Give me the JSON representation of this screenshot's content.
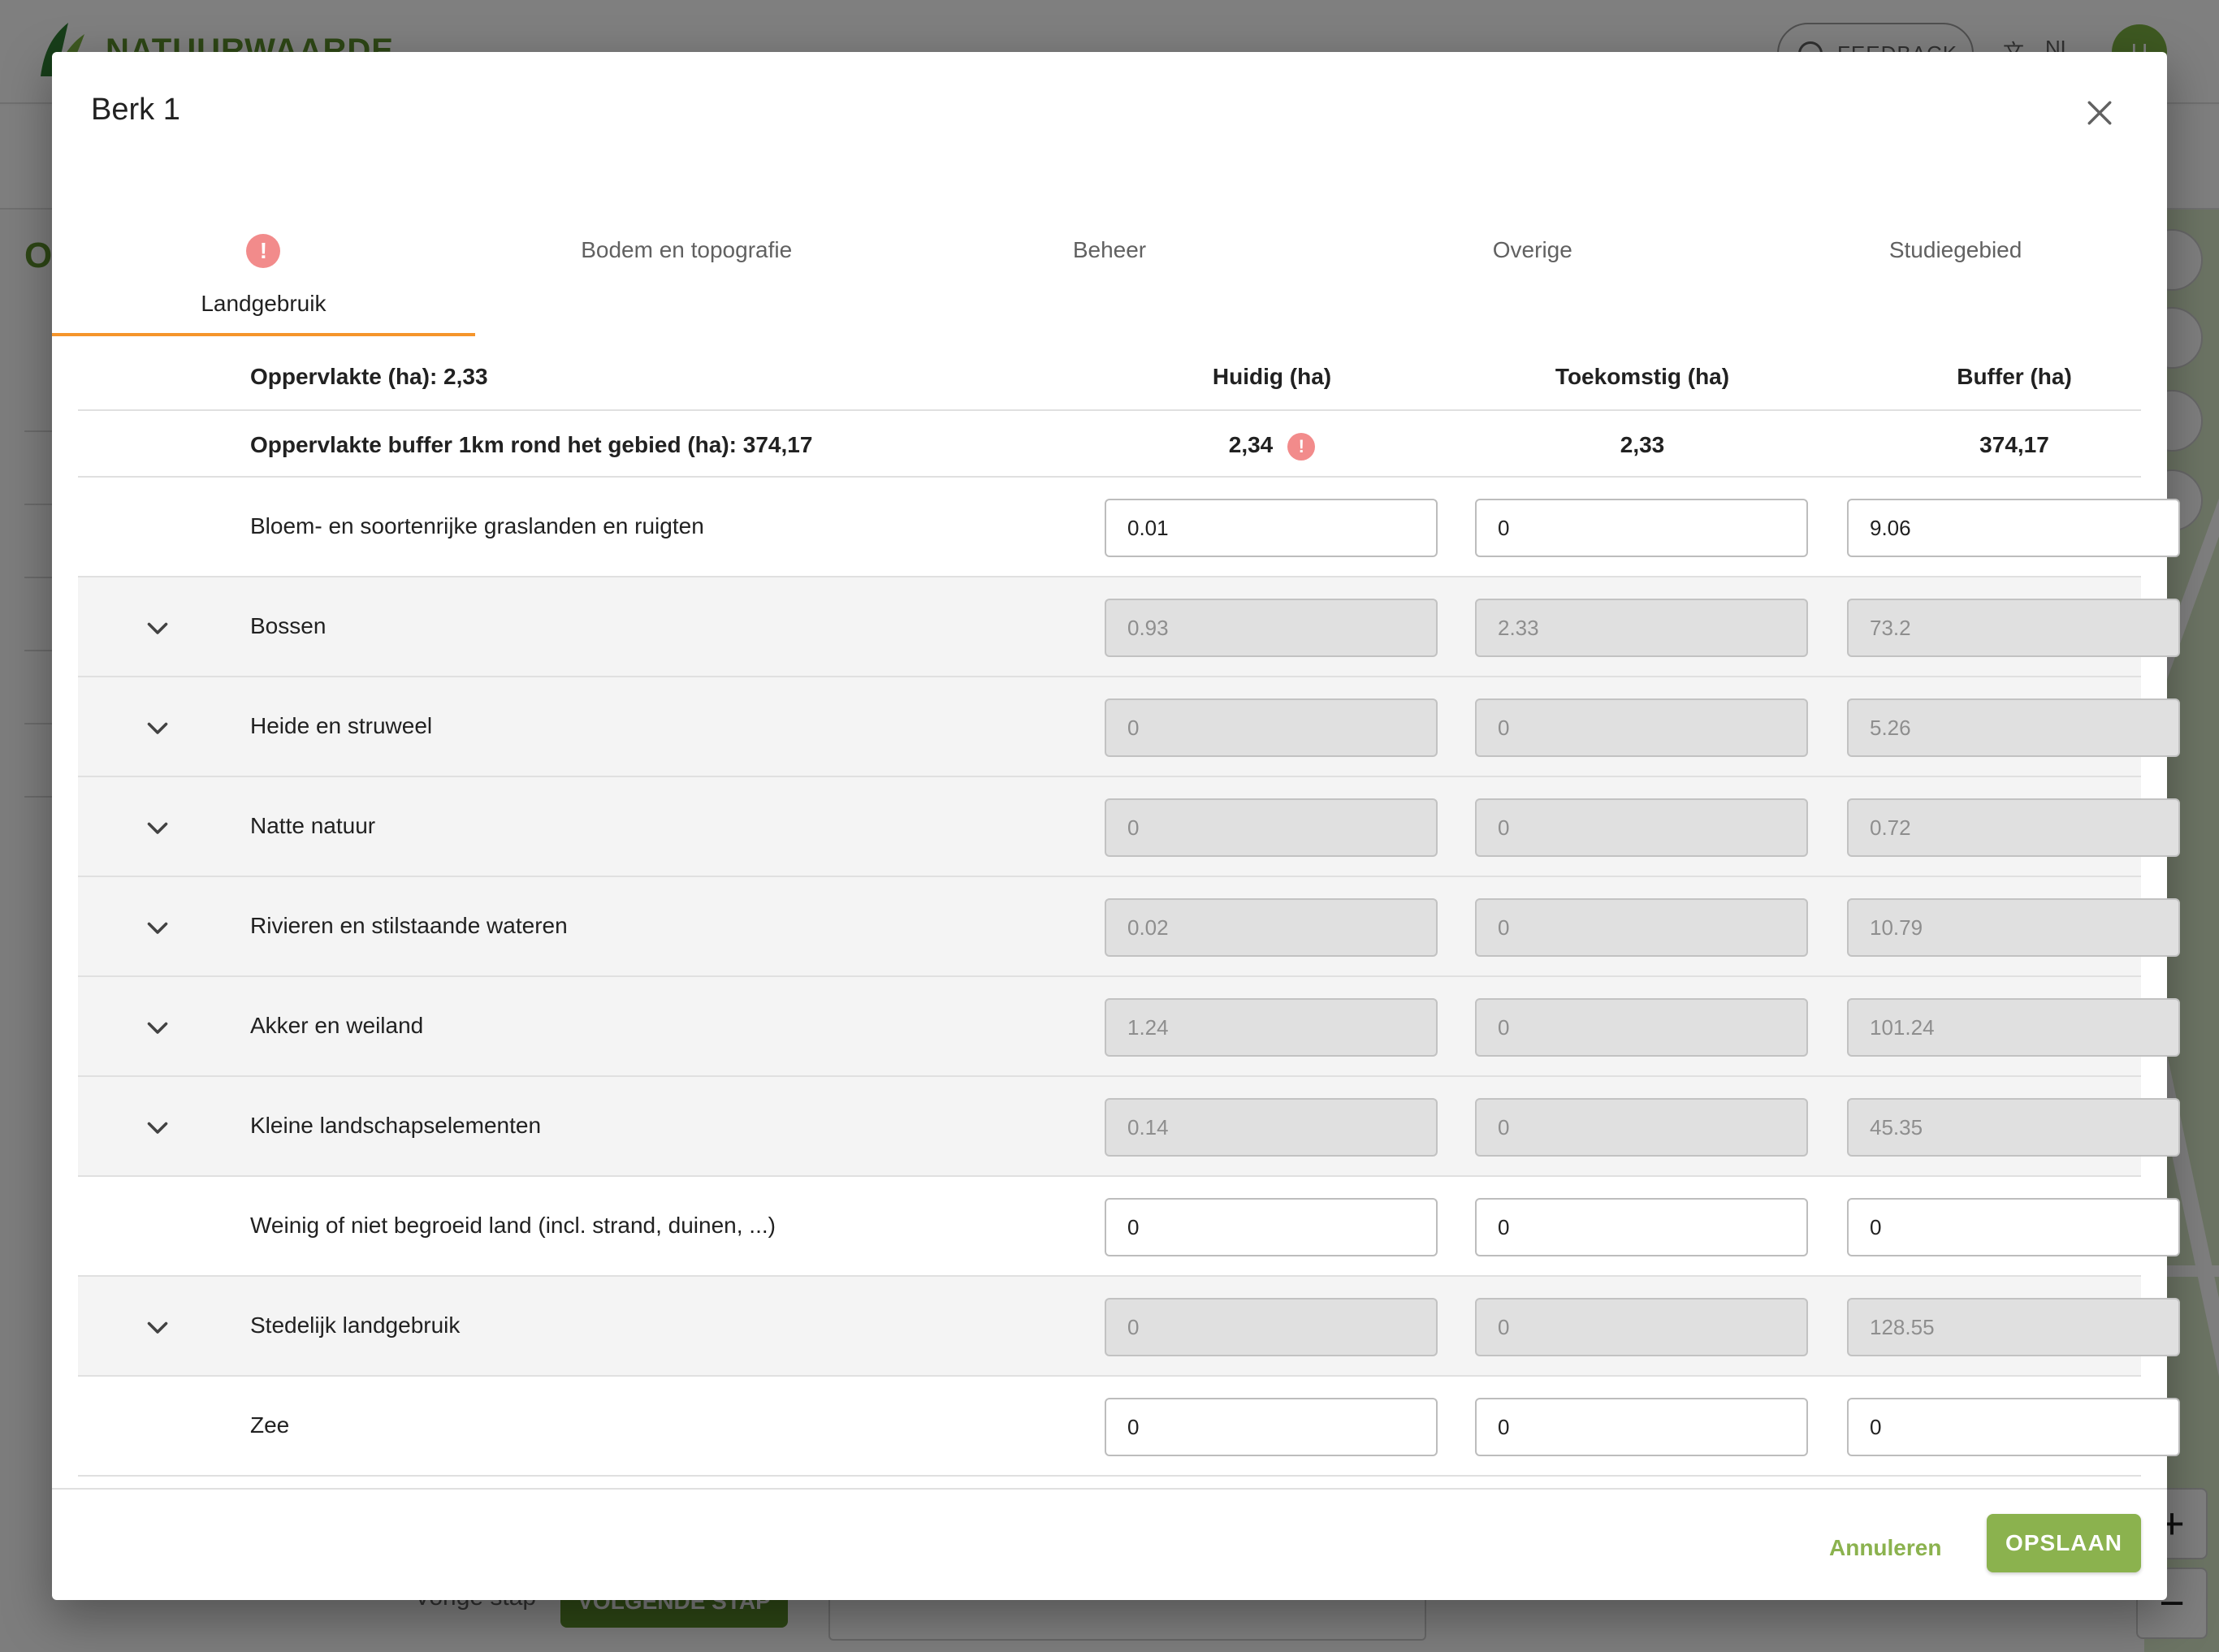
{
  "background": {
    "logo_text": "NATUURWAARDE",
    "feedback_label": "FEEDBACK",
    "language": "NL",
    "avatar_initial": "U",
    "side_letter": "O",
    "footer_prev": "Vorige stap",
    "footer_next": "VOLGENDE STAP",
    "map_zoom_in": "+",
    "map_zoom_out": "−"
  },
  "dialog": {
    "title": "Berk 1",
    "tabs": [
      {
        "label": "Landgebruik",
        "active": true,
        "alert": "!"
      },
      {
        "label": "Bodem en topografie",
        "active": false
      },
      {
        "label": "Beheer",
        "active": false
      },
      {
        "label": "Overige",
        "active": false
      },
      {
        "label": "Studiegebied",
        "active": false
      }
    ],
    "table": {
      "header": {
        "area": "Oppervlakte (ha): 2,33",
        "col_current": "Huidig (ha)",
        "col_future": "Toekomstig (ha)",
        "col_buffer": "Buffer (ha)"
      },
      "summary": {
        "label": "Oppervlakte buffer 1km rond het gebied (ha): 374,17",
        "current": "2,34",
        "current_alert": "!",
        "future": "2,33",
        "buffer": "374,17"
      },
      "rows": [
        {
          "label": "Bloem- en soortenrijke graslanden en ruigten",
          "expandable": false,
          "current": "0.01",
          "future": "0",
          "buffer": "9.06"
        },
        {
          "label": "Bossen",
          "expandable": true,
          "current": "0.93",
          "future": "2.33",
          "buffer": "73.2"
        },
        {
          "label": "Heide en struweel",
          "expandable": true,
          "current": "0",
          "future": "0",
          "buffer": "5.26"
        },
        {
          "label": "Natte natuur",
          "expandable": true,
          "current": "0",
          "future": "0",
          "buffer": "0.72"
        },
        {
          "label": "Rivieren en stilstaande wateren",
          "expandable": true,
          "current": "0.02",
          "future": "0",
          "buffer": "10.79"
        },
        {
          "label": "Akker en weiland",
          "expandable": true,
          "current": "1.24",
          "future": "0",
          "buffer": "101.24"
        },
        {
          "label": "Kleine landschapselementen",
          "expandable": true,
          "current": "0.14",
          "future": "0",
          "buffer": "45.35"
        },
        {
          "label": "Weinig of niet begroeid land (incl. strand, duinen, ...)",
          "expandable": false,
          "current": "0",
          "future": "0",
          "buffer": "0"
        },
        {
          "label": "Stedelijk landgebruik",
          "expandable": true,
          "current": "0",
          "future": "0",
          "buffer": "128.55"
        },
        {
          "label": "Zee",
          "expandable": false,
          "current": "0",
          "future": "0",
          "buffer": "0"
        }
      ]
    },
    "buttons": {
      "cancel": "Annuleren",
      "save": "OPSLAAN"
    },
    "colors": {
      "accent_tab": "#f5952b",
      "brand_green": "#8bb24e",
      "alert": "#f28b8b"
    }
  }
}
